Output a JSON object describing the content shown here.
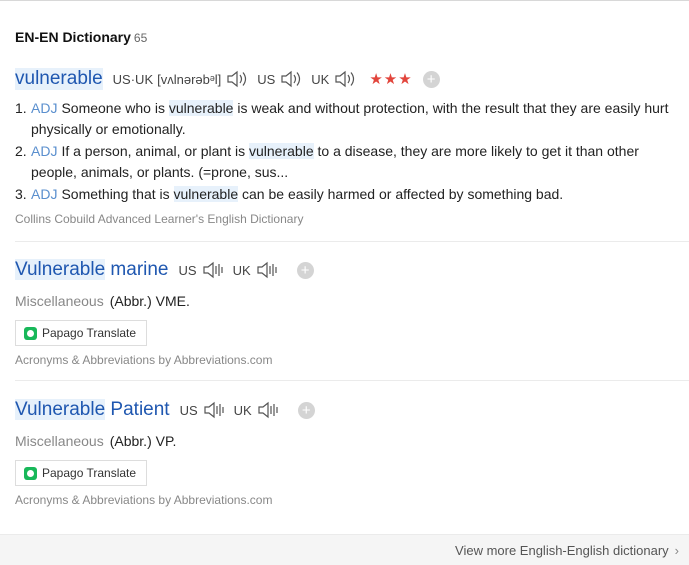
{
  "header": {
    "title": "EN-EN Dictionary",
    "count": "65"
  },
  "entries": [
    {
      "word": "vulnerable",
      "word_rest": "",
      "pron_label": "US·UK",
      "ipa": "[vʌlnərəbᵊl]",
      "us_label": "US",
      "uk_label": "UK",
      "stars": "★★★",
      "plus": "+",
      "definitions": [
        {
          "num": "1.",
          "pos": "ADJ",
          "before": "Someone who is ",
          "hl": "vulnerable",
          "after": " is weak and without protection, with the result that they are easily hurt physically or emotionally."
        },
        {
          "num": "2.",
          "pos": "ADJ",
          "before": "If a person, animal, or plant is ",
          "hl": "vulnerable",
          "after": " to a disease, they are more likely to get it than other people, animals, or plants. (=prone, sus..."
        },
        {
          "num": "3.",
          "pos": "ADJ",
          "before": "Something that is ",
          "hl": "vulnerable",
          "after": " can be easily harmed or affected by something bad."
        }
      ],
      "source": "Collins Cobuild Advanced Learner's English Dictionary"
    },
    {
      "word": "Vulnerable",
      "word_rest": " marine",
      "us_label": "US",
      "uk_label": "UK",
      "plus": "+",
      "category": "Miscellaneous",
      "abbr": "(Abbr.) VME.",
      "papago": "Papago Translate",
      "source": "Acronyms & Abbreviations by Abbreviations.com"
    },
    {
      "word": "Vulnerable",
      "word_rest": " Patient",
      "us_label": "US",
      "uk_label": "UK",
      "plus": "+",
      "category": "Miscellaneous",
      "abbr": "(Abbr.) VP.",
      "papago": "Papago Translate",
      "source": "Acronyms & Abbreviations by Abbreviations.com"
    }
  ],
  "footer": {
    "more_label": "View more English-English dictionary",
    "chevron": "›"
  },
  "colors": {
    "link_blue": "#1f57b0",
    "pos_blue": "#5a8fce",
    "highlight": "#e7f1fb",
    "star_red": "#e2453c",
    "papago_green": "#18b85a"
  }
}
